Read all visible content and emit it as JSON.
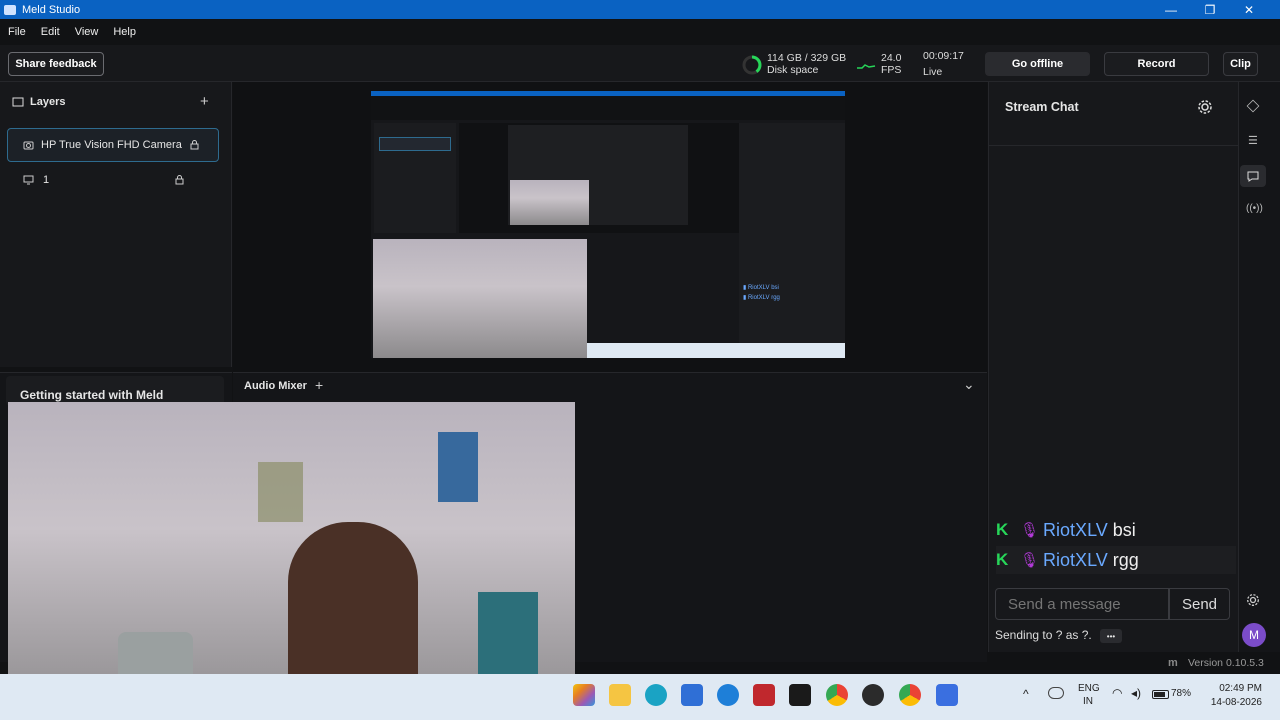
{
  "window": {
    "title": "Meld Studio",
    "minimize": "—",
    "maximize": "❐",
    "close": "✕"
  },
  "menu": [
    "File",
    "Edit",
    "View",
    "Help"
  ],
  "toolbar": {
    "share_feedback": "Share feedback",
    "disk_value": "114 GB / 329 GB",
    "disk_label": "Disk space",
    "fps_value": "24.0",
    "fps_label": "FPS",
    "time_value": "00:09:17",
    "time_label": "Live",
    "go_offline": "Go offline",
    "record": "Record",
    "clip": "Clip"
  },
  "layers": {
    "title": "Layers",
    "add": "+",
    "items": [
      {
        "label": "HP True Vision FHD Camera",
        "selected": true
      },
      {
        "label": "1",
        "selected": false
      }
    ]
  },
  "getting_started": {
    "title": "Getting started with Meld"
  },
  "mixer": {
    "title": "Audio Mixer",
    "add": "+",
    "chevron": "⌄"
  },
  "chat": {
    "title": "Stream Chat",
    "messages": [
      {
        "user": "RiotXLV",
        "text": "bsi"
      },
      {
        "user": "RiotXLV",
        "text": "rgg"
      }
    ],
    "input_placeholder": "Send a message",
    "send": "Send",
    "sending_to": "Sending to ? as ?.",
    "more": "•••",
    "avatar": "M"
  },
  "status": {
    "version": "Version 0.10.5.3"
  },
  "taskbar": {
    "lang_top": "ENG",
    "lang_bottom": "IN",
    "battery": "78%",
    "time": "02:49 PM",
    "date": "14-08-2026"
  },
  "colors": {
    "accent": "#0a62c2",
    "twitch_green": "#27d659",
    "mic_purple": "#b13ad6",
    "user_blue": "#6aa9ff"
  }
}
